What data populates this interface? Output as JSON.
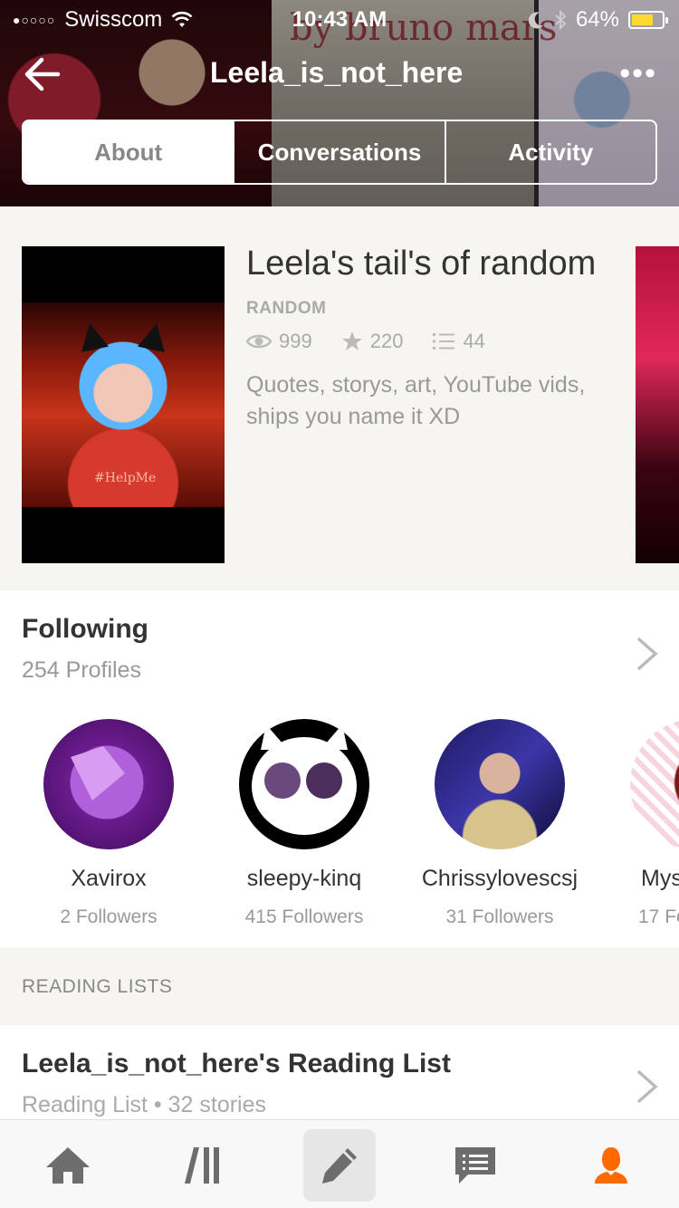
{
  "status_bar": {
    "signal": "●○○○○",
    "carrier": "Swisscom",
    "time": "10:43 AM",
    "battery": "64%",
    "battery_level": 0.64
  },
  "header": {
    "background_text": "by bruno mars",
    "title": "Leela_is_not_here",
    "more_label": "•••",
    "tabs": [
      {
        "label": "About",
        "selected": true
      },
      {
        "label": "Conversations",
        "selected": false
      },
      {
        "label": "Activity",
        "selected": false
      }
    ]
  },
  "story": {
    "title": "Leela's tail's of random",
    "category": "RANDOM",
    "reads": "999",
    "votes": "220",
    "parts": "44",
    "description": "Quotes, storys, art, YouTube vids, ships you name it XD",
    "cover_caption": "#HelpMe"
  },
  "following": {
    "heading": "Following",
    "count": "254 Profiles",
    "profiles": [
      {
        "name": "Xavirox",
        "followers": "2 Followers"
      },
      {
        "name": "sleepy-kinq",
        "followers": "415 Followers"
      },
      {
        "name": "Chrissylovescsj",
        "followers": "31 Followers"
      },
      {
        "name": "Mys",
        "followers": "17 Fo"
      }
    ]
  },
  "reading_lists": {
    "section_label": "READING LISTS",
    "items": [
      {
        "title": "Leela_is_not_here's Reading List",
        "subtitle": "Reading List • 32 stories"
      }
    ]
  },
  "tab_bar": {
    "items": [
      "home-icon",
      "library-icon",
      "write-icon",
      "messages-icon",
      "profile-icon"
    ],
    "active": "profile-icon"
  },
  "colors": {
    "accent": "#ff6a00",
    "icon_gray": "#6d6d6d",
    "text_dark": "#333333",
    "text_muted": "#999999"
  }
}
